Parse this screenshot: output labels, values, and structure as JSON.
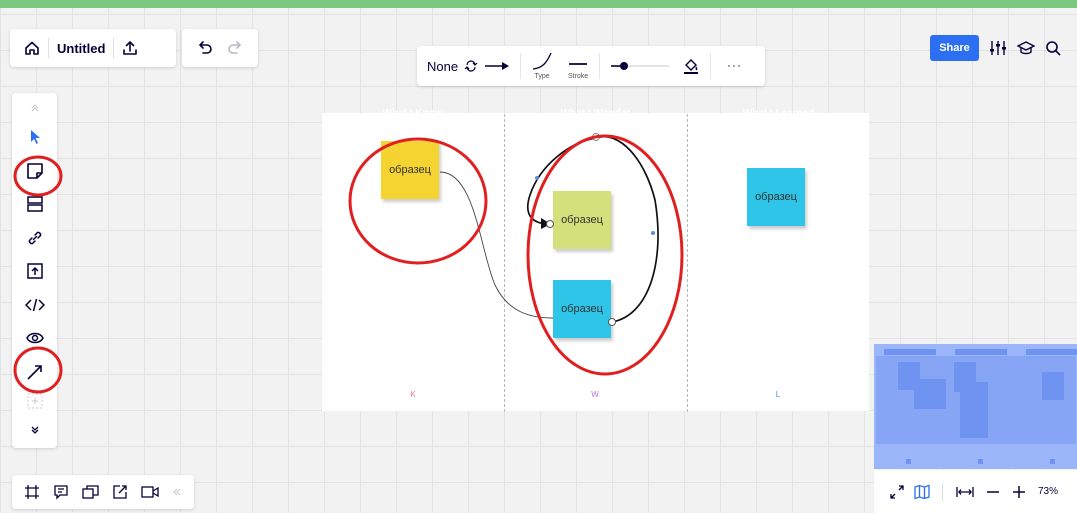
{
  "header": {
    "board_title": "Untitled",
    "share_label": "Share"
  },
  "context_toolbar": {
    "line_start": "None",
    "type_label": "Type",
    "stroke_label": "Stroke"
  },
  "board": {
    "columns": [
      {
        "title": "What I Know",
        "letter": "K",
        "color": "#f3758b"
      },
      {
        "title": "What I Wonder",
        "letter": "W",
        "color": "#b777cf"
      },
      {
        "title": "What I Learned",
        "letter": "L",
        "color": "#5b8bd9"
      }
    ],
    "stickies": [
      {
        "text": "образец",
        "color": "#f5d431"
      },
      {
        "text": "образец",
        "color": "#d4e07b"
      },
      {
        "text": "образец",
        "color": "#2ec5e8"
      },
      {
        "text": "образец",
        "color": "#2ec5e8"
      }
    ]
  },
  "annotation_color": "#e02020",
  "zoom": {
    "level": "73%"
  }
}
